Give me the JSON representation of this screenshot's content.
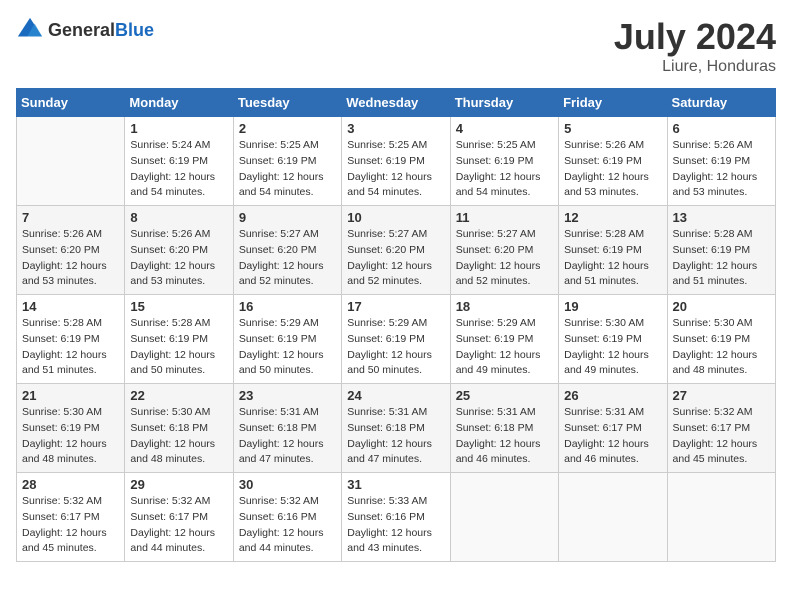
{
  "header": {
    "logo_general": "General",
    "logo_blue": "Blue",
    "month": "July 2024",
    "location": "Liure, Honduras"
  },
  "calendar": {
    "days_of_week": [
      "Sunday",
      "Monday",
      "Tuesday",
      "Wednesday",
      "Thursday",
      "Friday",
      "Saturday"
    ],
    "weeks": [
      [
        {
          "day": "",
          "info": ""
        },
        {
          "day": "1",
          "info": "Sunrise: 5:24 AM\nSunset: 6:19 PM\nDaylight: 12 hours\nand 54 minutes."
        },
        {
          "day": "2",
          "info": "Sunrise: 5:25 AM\nSunset: 6:19 PM\nDaylight: 12 hours\nand 54 minutes."
        },
        {
          "day": "3",
          "info": "Sunrise: 5:25 AM\nSunset: 6:19 PM\nDaylight: 12 hours\nand 54 minutes."
        },
        {
          "day": "4",
          "info": "Sunrise: 5:25 AM\nSunset: 6:19 PM\nDaylight: 12 hours\nand 54 minutes."
        },
        {
          "day": "5",
          "info": "Sunrise: 5:26 AM\nSunset: 6:19 PM\nDaylight: 12 hours\nand 53 minutes."
        },
        {
          "day": "6",
          "info": "Sunrise: 5:26 AM\nSunset: 6:19 PM\nDaylight: 12 hours\nand 53 minutes."
        }
      ],
      [
        {
          "day": "7",
          "info": "Sunrise: 5:26 AM\nSunset: 6:20 PM\nDaylight: 12 hours\nand 53 minutes."
        },
        {
          "day": "8",
          "info": "Sunrise: 5:26 AM\nSunset: 6:20 PM\nDaylight: 12 hours\nand 53 minutes."
        },
        {
          "day": "9",
          "info": "Sunrise: 5:27 AM\nSunset: 6:20 PM\nDaylight: 12 hours\nand 52 minutes."
        },
        {
          "day": "10",
          "info": "Sunrise: 5:27 AM\nSunset: 6:20 PM\nDaylight: 12 hours\nand 52 minutes."
        },
        {
          "day": "11",
          "info": "Sunrise: 5:27 AM\nSunset: 6:20 PM\nDaylight: 12 hours\nand 52 minutes."
        },
        {
          "day": "12",
          "info": "Sunrise: 5:28 AM\nSunset: 6:19 PM\nDaylight: 12 hours\nand 51 minutes."
        },
        {
          "day": "13",
          "info": "Sunrise: 5:28 AM\nSunset: 6:19 PM\nDaylight: 12 hours\nand 51 minutes."
        }
      ],
      [
        {
          "day": "14",
          "info": "Sunrise: 5:28 AM\nSunset: 6:19 PM\nDaylight: 12 hours\nand 51 minutes."
        },
        {
          "day": "15",
          "info": "Sunrise: 5:28 AM\nSunset: 6:19 PM\nDaylight: 12 hours\nand 50 minutes."
        },
        {
          "day": "16",
          "info": "Sunrise: 5:29 AM\nSunset: 6:19 PM\nDaylight: 12 hours\nand 50 minutes."
        },
        {
          "day": "17",
          "info": "Sunrise: 5:29 AM\nSunset: 6:19 PM\nDaylight: 12 hours\nand 50 minutes."
        },
        {
          "day": "18",
          "info": "Sunrise: 5:29 AM\nSunset: 6:19 PM\nDaylight: 12 hours\nand 49 minutes."
        },
        {
          "day": "19",
          "info": "Sunrise: 5:30 AM\nSunset: 6:19 PM\nDaylight: 12 hours\nand 49 minutes."
        },
        {
          "day": "20",
          "info": "Sunrise: 5:30 AM\nSunset: 6:19 PM\nDaylight: 12 hours\nand 48 minutes."
        }
      ],
      [
        {
          "day": "21",
          "info": "Sunrise: 5:30 AM\nSunset: 6:19 PM\nDaylight: 12 hours\nand 48 minutes."
        },
        {
          "day": "22",
          "info": "Sunrise: 5:30 AM\nSunset: 6:18 PM\nDaylight: 12 hours\nand 48 minutes."
        },
        {
          "day": "23",
          "info": "Sunrise: 5:31 AM\nSunset: 6:18 PM\nDaylight: 12 hours\nand 47 minutes."
        },
        {
          "day": "24",
          "info": "Sunrise: 5:31 AM\nSunset: 6:18 PM\nDaylight: 12 hours\nand 47 minutes."
        },
        {
          "day": "25",
          "info": "Sunrise: 5:31 AM\nSunset: 6:18 PM\nDaylight: 12 hours\nand 46 minutes."
        },
        {
          "day": "26",
          "info": "Sunrise: 5:31 AM\nSunset: 6:17 PM\nDaylight: 12 hours\nand 46 minutes."
        },
        {
          "day": "27",
          "info": "Sunrise: 5:32 AM\nSunset: 6:17 PM\nDaylight: 12 hours\nand 45 minutes."
        }
      ],
      [
        {
          "day": "28",
          "info": "Sunrise: 5:32 AM\nSunset: 6:17 PM\nDaylight: 12 hours\nand 45 minutes."
        },
        {
          "day": "29",
          "info": "Sunrise: 5:32 AM\nSunset: 6:17 PM\nDaylight: 12 hours\nand 44 minutes."
        },
        {
          "day": "30",
          "info": "Sunrise: 5:32 AM\nSunset: 6:16 PM\nDaylight: 12 hours\nand 44 minutes."
        },
        {
          "day": "31",
          "info": "Sunrise: 5:33 AM\nSunset: 6:16 PM\nDaylight: 12 hours\nand 43 minutes."
        },
        {
          "day": "",
          "info": ""
        },
        {
          "day": "",
          "info": ""
        },
        {
          "day": "",
          "info": ""
        }
      ]
    ]
  }
}
